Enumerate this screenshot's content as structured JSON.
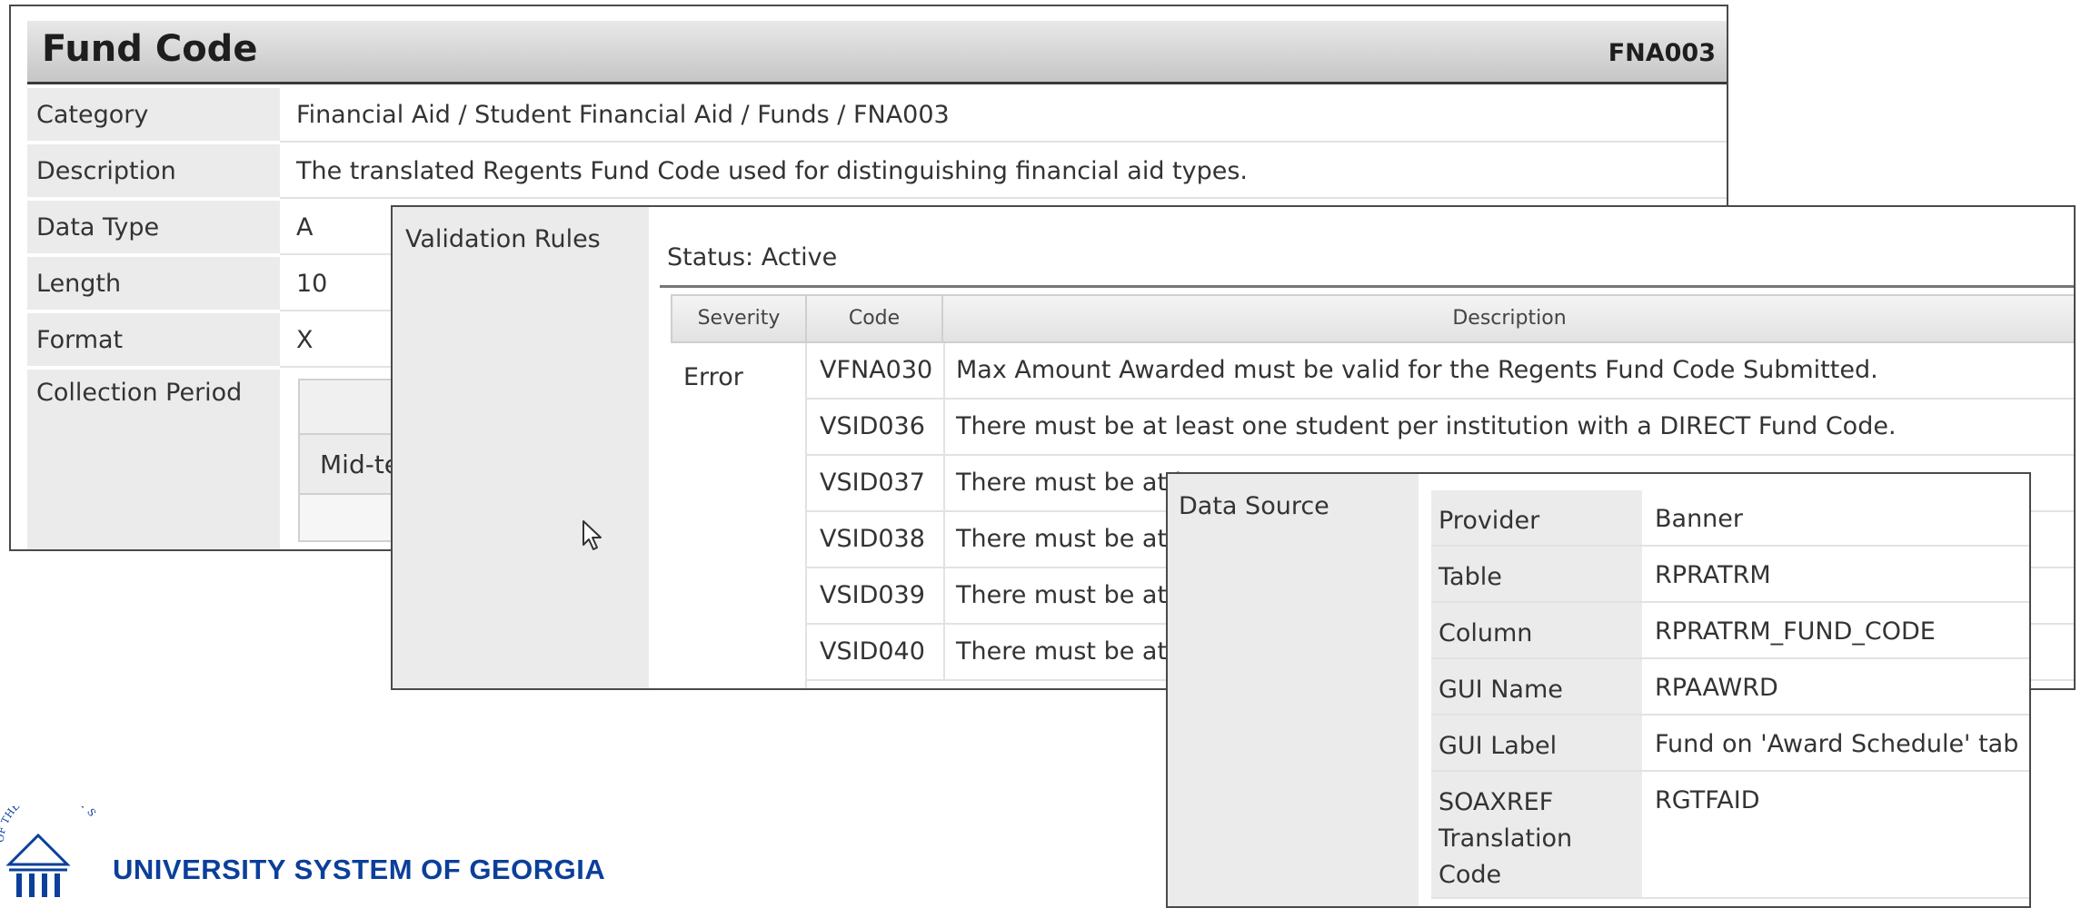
{
  "fund_code": {
    "title": "Fund Code",
    "code": "FNA003",
    "fields": [
      {
        "label": "Category",
        "value": "Financial Aid / Student Financial Aid / Funds / FNA003"
      },
      {
        "label": "Description",
        "value": "The translated Regents Fund Code used for distinguishing financial aid types."
      },
      {
        "label": "Data Type",
        "value": "A"
      },
      {
        "label": "Length",
        "value": "10"
      },
      {
        "label": "Format",
        "value": "X"
      },
      {
        "label": "Collection Period",
        "value": ""
      }
    ],
    "collection_period_visible_text": "Mid-te"
  },
  "validation_rules": {
    "label": "Validation Rules",
    "status": "Status: Active",
    "columns": [
      "Severity",
      "Code",
      "Description"
    ],
    "severity": "Error",
    "rows": [
      {
        "code": "VFNA030",
        "description": "Max Amount Awarded must be valid for the Regents Fund Code Submitted."
      },
      {
        "code": "VSID036",
        "description": "There must be at least one student per institution with a DIRECT Fund Code."
      },
      {
        "code": "VSID037",
        "description": "There must be at l"
      },
      {
        "code": "VSID038",
        "description": "There must be at l"
      },
      {
        "code": "VSID039",
        "description": "There must be at l"
      },
      {
        "code": "VSID040",
        "description": "There must be at l"
      }
    ]
  },
  "data_source": {
    "label": "Data Source",
    "rows": [
      {
        "key": "Provider",
        "value": "Banner"
      },
      {
        "key": "Table",
        "value": "RPRATRM"
      },
      {
        "key": "Column",
        "value": "RPRATRM_FUND_CODE"
      },
      {
        "key": "GUI Name",
        "value": "RPAAWRD"
      },
      {
        "key": "GUI Label",
        "value": "Fund on 'Award Schedule' tab"
      },
      {
        "key": "SOAXREF Translation Code",
        "value": "RGTFAID"
      }
    ]
  },
  "logo": {
    "text": "UNIVERSITY SYSTEM OF GEORGIA",
    "seal_text": "OF THE UNIVERSITY S",
    "color": "#0b3f9a"
  }
}
